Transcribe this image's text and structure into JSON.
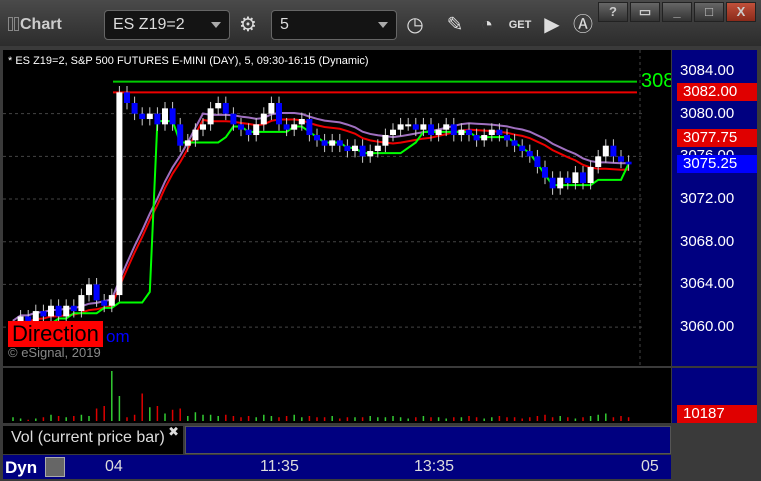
{
  "app": {
    "title": "Chart",
    "symbol": "ES Z19=2",
    "interval": "5"
  },
  "chart": {
    "header": "* ES Z19=2, S&P 500 FUTURES E-MINI (DAY), 5, 09:30-16:15 (Dynamic)",
    "watermark": "Direction",
    "watermark_tail": "om",
    "copyright": "© eSignal, 2019",
    "partial_label": "308",
    "price_labels": [
      "3084.00",
      "3080.00",
      "3076.00",
      "3072.00",
      "3068.00",
      "3064.00",
      "3060.00"
    ],
    "markers": [
      {
        "text": "3082.00",
        "color": "#e00000",
        "price": 3082
      },
      {
        "text": "3077.75",
        "color": "#e00000",
        "price": 3077.75
      },
      {
        "text": "3075.25",
        "color": "#0000ff",
        "price": 3075.25
      }
    ],
    "closes": [
      3060,
      3061,
      3060.5,
      3061.5,
      3061,
      3062,
      3061,
      3062,
      3061.5,
      3063,
      3064,
      3062.5,
      3062,
      3063,
      3082,
      3081,
      3080,
      3079.5,
      3080,
      3079,
      3080.5,
      3079,
      3077,
      3077.5,
      3078.5,
      3079,
      3080.5,
      3081,
      3080,
      3079,
      3078.5,
      3078,
      3079,
      3080,
      3081,
      3079,
      3078.5,
      3079,
      3079.5,
      3078,
      3077.5,
      3077,
      3077.5,
      3077,
      3076.5,
      3077,
      3076,
      3076.5,
      3077,
      3078,
      3078.5,
      3079,
      3079,
      3078.5,
      3079,
      3078,
      3078.5,
      3079,
      3078,
      3078.5,
      3078,
      3077.5,
      3078,
      3078.5,
      3078,
      3077.5,
      3077,
      3076.5,
      3076,
      3075,
      3074,
      3073,
      3074,
      3073.5,
      3074.5,
      3073.5,
      3075,
      3076,
      3077,
      3076,
      3075.5,
      3075.25
    ],
    "volumes": [
      3,
      2,
      1,
      2,
      3,
      5,
      4,
      3,
      4,
      5,
      4,
      10,
      12,
      40,
      20,
      3,
      5,
      22,
      11,
      12,
      6,
      9,
      10,
      4,
      7,
      5,
      5,
      4,
      5,
      4,
      3,
      4,
      3,
      5,
      4,
      3,
      4,
      5,
      3,
      4,
      3,
      3,
      4,
      2,
      3,
      3,
      3,
      4,
      3,
      3,
      4,
      3,
      2,
      3,
      4,
      3,
      3,
      2,
      3,
      3,
      4,
      3,
      2,
      3,
      4,
      3,
      3,
      2,
      3,
      4,
      5,
      3,
      4,
      3,
      2,
      3,
      4,
      5,
      6,
      3,
      4,
      3
    ]
  },
  "volume": {
    "label": "Vol (current price bar)",
    "value": "10187"
  },
  "xaxis": {
    "mode": "Dyn",
    "ticks": [
      "04",
      "11:35",
      "13:35",
      "05"
    ]
  }
}
